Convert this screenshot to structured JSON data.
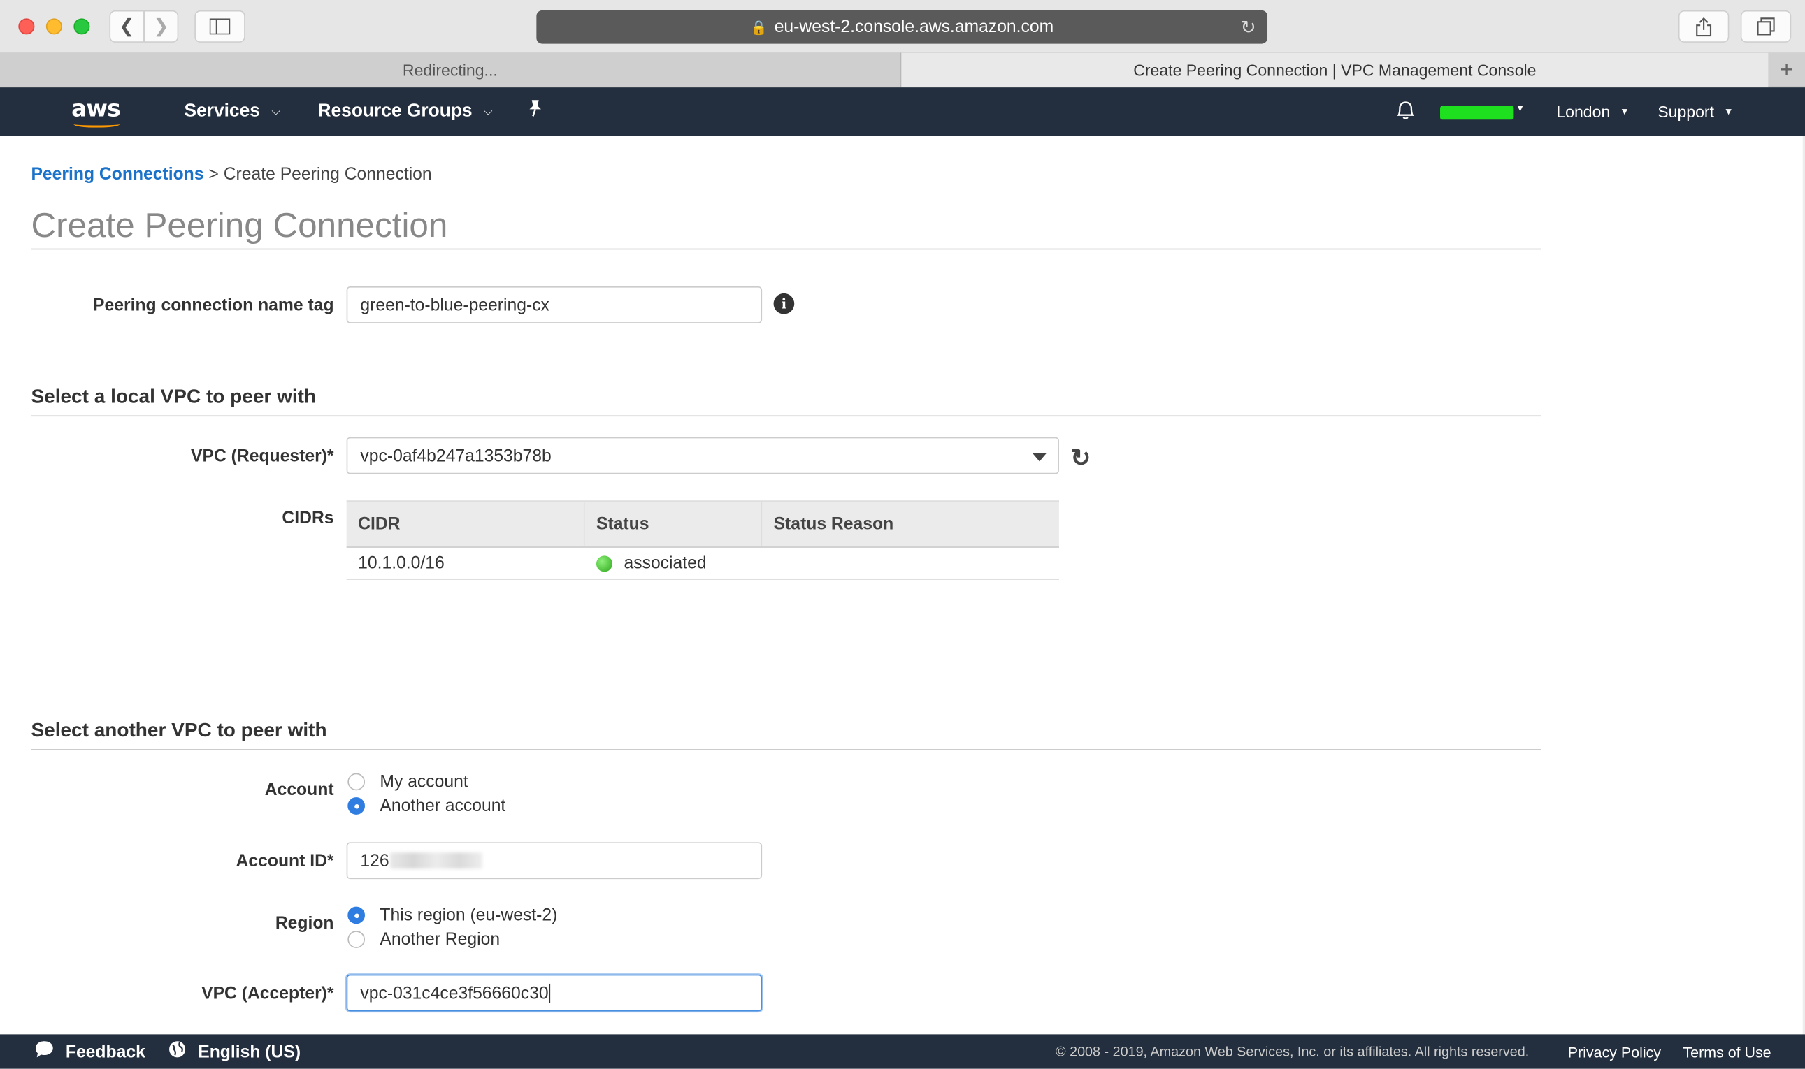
{
  "browser": {
    "url": "eu-west-2.console.aws.amazon.com",
    "tabs": [
      {
        "title": "Redirecting..."
      },
      {
        "title": "Create Peering Connection | VPC Management Console"
      }
    ]
  },
  "aws_nav": {
    "services": "Services",
    "resource_groups": "Resource Groups",
    "region": "London",
    "support": "Support",
    "account_badge_color": "#1ee01e"
  },
  "breadcrumb": {
    "parent": "Peering Connections",
    "separator": ">",
    "current": "Create Peering Connection"
  },
  "page": {
    "title": "Create Peering Connection"
  },
  "name_tag": {
    "label": "Peering connection name tag",
    "value": "green-to-blue-peering-cx"
  },
  "local_section": {
    "heading": "Select a local VPC to peer with",
    "vpc_label": "VPC (Requester)*",
    "vpc_value": "vpc-0af4b247a1353b78b",
    "cidrs_label": "CIDRs",
    "columns": [
      "CIDR",
      "Status",
      "Status Reason"
    ],
    "rows": [
      {
        "cidr": "10.1.0.0/16",
        "status": "associated",
        "reason": ""
      }
    ]
  },
  "peer_section": {
    "heading": "Select another VPC to peer with",
    "account_label": "Account",
    "account_options": [
      "My account",
      "Another account"
    ],
    "account_selected": "Another account",
    "account_id_label": "Account ID*",
    "account_id_value": "126",
    "region_label": "Region",
    "region_options": [
      "This region (eu-west-2)",
      "Another Region"
    ],
    "region_selected": "This region (eu-west-2)",
    "vpc_accepter_label": "VPC (Accepter)*",
    "vpc_accepter_value": "vpc-031c4ce3f56660c30"
  },
  "footer": {
    "feedback": "Feedback",
    "language": "English (US)",
    "copyright": "© 2008 - 2019, Amazon Web Services, Inc. or its affiliates. All rights reserved.",
    "privacy": "Privacy Policy",
    "terms": "Terms of Use"
  }
}
